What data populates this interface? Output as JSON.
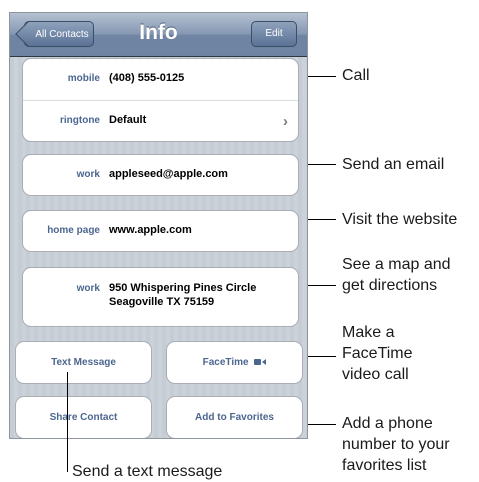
{
  "navbar": {
    "back_label": "All Contacts",
    "title": "Info",
    "edit_label": "Edit"
  },
  "phone_group": [
    {
      "label": "mobile",
      "value": "(408) 555-0125"
    },
    {
      "label": "ringtone",
      "value": "Default"
    }
  ],
  "email": {
    "label": "work",
    "value": "appleseed@apple.com"
  },
  "homepage": {
    "label": "home page",
    "value": "www.apple.com"
  },
  "address": {
    "label": "work",
    "line1": "950 Whispering Pines Circle",
    "line2": "Seagoville TX 75159"
  },
  "buttons": {
    "text_message": "Text Message",
    "facetime": "FaceTime",
    "share_contact": "Share Contact",
    "add_favorites": "Add to Favorites"
  },
  "callouts": {
    "call": "Call",
    "email": "Send an email",
    "website": "Visit the website",
    "map_line1": "See a map and",
    "map_line2": "get directions",
    "facetime_line1": "Make a",
    "facetime_line2": "FaceTime",
    "facetime_line3": "video call",
    "favorites_line1": "Add a phone",
    "favorites_line2": "number to your",
    "favorites_line3": "favorites list",
    "text": "Send a text message"
  },
  "icons": {
    "chevron": "chevron-right-icon",
    "facetime": "video-camera-icon"
  },
  "colors": {
    "label_blue": "#4c6690",
    "nav_blue": "#6d83a1"
  }
}
